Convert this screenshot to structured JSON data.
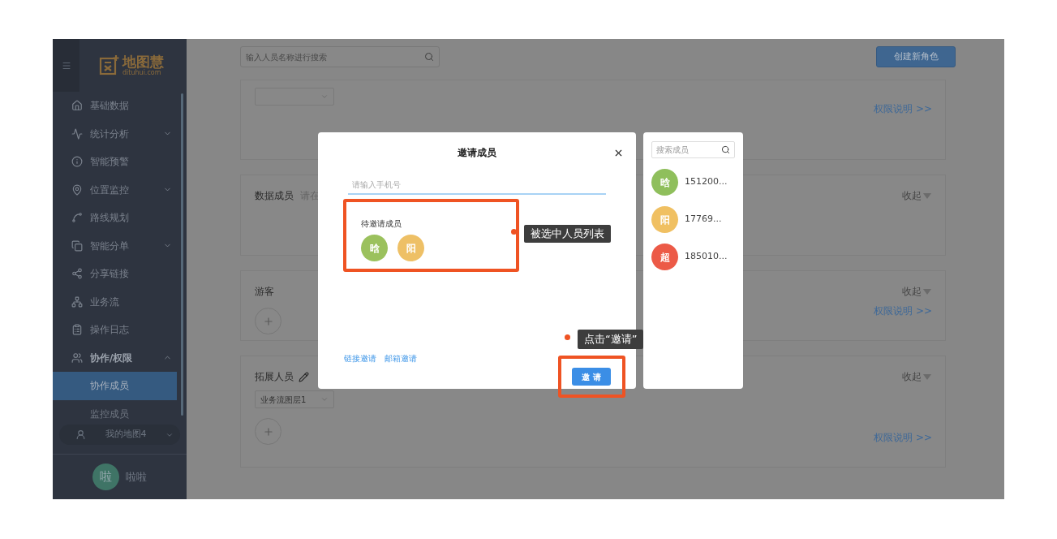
{
  "sidebar": {
    "logo": {
      "name": "地图慧",
      "domain": "dituhui.com"
    },
    "items": [
      {
        "label": "基础数据",
        "kind": "link"
      },
      {
        "label": "统计分析",
        "kind": "group",
        "expanded": false
      },
      {
        "label": "智能预警",
        "kind": "link"
      },
      {
        "label": "位置监控",
        "kind": "group",
        "expanded": false
      },
      {
        "label": "路线规划",
        "kind": "link"
      },
      {
        "label": "智能分单",
        "kind": "group",
        "expanded": false
      },
      {
        "label": "分享链接",
        "kind": "link"
      },
      {
        "label": "业务流",
        "kind": "link"
      },
      {
        "label": "操作日志",
        "kind": "link"
      },
      {
        "label": "协作/权限",
        "kind": "group",
        "expanded": true,
        "children": [
          {
            "label": "协作成员",
            "selected": true
          },
          {
            "label": "监控成员",
            "selected": false
          }
        ]
      }
    ],
    "map_switcher": {
      "label": "我的地图4"
    },
    "user": {
      "avatar": "啦",
      "name": "啦啦"
    }
  },
  "main": {
    "search": {
      "placeholder": "输入人员名称进行搜索"
    },
    "create_button": "创建新角色",
    "cards": [
      {
        "has_select": true,
        "link": "权限说明 >>"
      },
      {
        "title": "数据成员",
        "hint": "请在",
        "toggle": "收起"
      },
      {
        "title": "游客",
        "toggle": "收起",
        "add_button": true,
        "link": "权限说明 >>"
      },
      {
        "title": "拓展人员",
        "editable": true,
        "toggle": "收起",
        "has_select": true,
        "select_value": "业务流图层1",
        "add_button": true,
        "link": "权限说明 >>"
      }
    ]
  },
  "dialog": {
    "title": "邀请成员",
    "phone_field": {
      "placeholder": "请输入手机号"
    },
    "pending": {
      "label": "待邀请成员",
      "members": [
        {
          "avatar": "晗",
          "color": "#9bc15d"
        },
        {
          "avatar": "阳",
          "color": "#eec066"
        }
      ]
    },
    "links": [
      "链接邀请",
      "邮箱邀请"
    ],
    "invite_button": "邀 请"
  },
  "member_panel": {
    "search": {
      "placeholder": "搜索成员"
    },
    "members": [
      {
        "avatar": "晗",
        "name": "151200...",
        "color": "#8fbf5c"
      },
      {
        "avatar": "阳",
        "name": "17769...",
        "color": "#f0c062"
      },
      {
        "avatar": "超",
        "name": "185010...",
        "color": "#ec5a47"
      }
    ]
  },
  "annotations": [
    {
      "text": "被选中人员列表"
    },
    {
      "text": "点击“邀请”"
    }
  ]
}
